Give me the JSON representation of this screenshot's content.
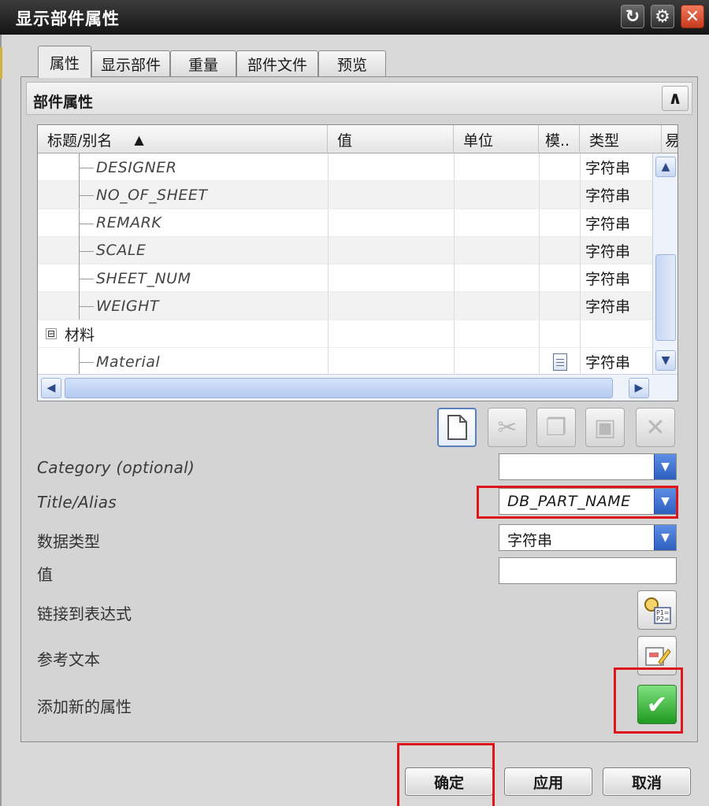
{
  "window": {
    "title": "显示部件属性"
  },
  "titlebar_icons": [
    "reset-icon",
    "gear-icon",
    "close-icon"
  ],
  "tabs": [
    {
      "label": "属性"
    },
    {
      "label": "显示部件"
    },
    {
      "label": "重量"
    },
    {
      "label": "部件文件"
    },
    {
      "label": "预览"
    }
  ],
  "group": {
    "title": "部件属性",
    "collapse_glyph": "∧"
  },
  "table": {
    "columns": [
      "标题/别名",
      "值",
      "单位",
      "模..",
      "类型",
      "易"
    ],
    "sort_glyph": "▲",
    "rows": [
      {
        "name": "DESIGNER",
        "value": "",
        "unit": "",
        "template": "",
        "type": "字符串"
      },
      {
        "name": "NO_OF_SHEET",
        "value": "",
        "unit": "",
        "template": "",
        "type": "字符串"
      },
      {
        "name": "REMARK",
        "value": "",
        "unit": "",
        "template": "",
        "type": "字符串"
      },
      {
        "name": "SCALE",
        "value": "",
        "unit": "",
        "template": "",
        "type": "字符串"
      },
      {
        "name": "SHEET_NUM",
        "value": "",
        "unit": "",
        "template": "",
        "type": "字符串"
      },
      {
        "name": "WEIGHT",
        "value": "",
        "unit": "",
        "template": "",
        "type": "字符串"
      },
      {
        "category": "材料",
        "expander": "⊟"
      },
      {
        "name": "Material",
        "value": "",
        "unit": "",
        "template": "doc-icon",
        "type": "字符串"
      }
    ]
  },
  "toolbar": {
    "buttons": [
      {
        "name": "new-document-icon",
        "enabled": true
      },
      {
        "name": "cut-icon",
        "enabled": false
      },
      {
        "name": "copy-icon",
        "enabled": false
      },
      {
        "name": "paste-icon",
        "enabled": false
      },
      {
        "name": "delete-icon",
        "enabled": false
      }
    ]
  },
  "form": {
    "category_label": "Category (optional)",
    "category_value": "",
    "title_label": "Title/Alias",
    "title_value": "DB_PART_NAME",
    "datatype_label": "数据类型",
    "datatype_value": "字符串",
    "value_label": "值",
    "value_value": "",
    "link_label": "链接到表达式",
    "reference_label": "参考文本",
    "add_label": "添加新的属性",
    "link_icon_text": "P1=\nP2="
  },
  "footer": {
    "ok": "确定",
    "apply": "应用",
    "cancel": "取消"
  },
  "colors": {
    "highlight": "#e0151b",
    "accent": "#2d5fbf",
    "confirm": "#1f9a1f"
  }
}
